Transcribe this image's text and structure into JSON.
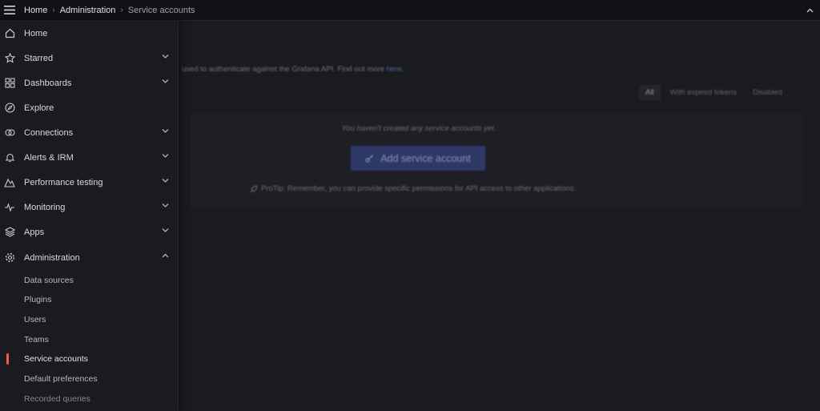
{
  "topbar": {
    "breadcrumbs": [
      "Home",
      "Administration",
      "Service accounts"
    ]
  },
  "main": {
    "description": "used to authenticate against the Grafana API. Find out more",
    "description_link": "here.",
    "filters": [
      "All",
      "With expired tokens",
      "Disabled"
    ],
    "empty_text": "You haven't created any service accounts yet.",
    "add_button": "Add service account",
    "protip": "ProTip: Remember, you can provide specific permissions for API access to other applications."
  },
  "sidebar": {
    "items": [
      {
        "label": "Home",
        "icon": "home-icon"
      },
      {
        "label": "Starred",
        "icon": "star-icon"
      },
      {
        "label": "Dashboards",
        "icon": "dashboards-icon"
      },
      {
        "label": "Explore",
        "icon": "compass-icon"
      },
      {
        "label": "Connections",
        "icon": "connections-icon"
      },
      {
        "label": "Alerts & IRM",
        "icon": "bell-icon"
      },
      {
        "label": "Performance testing",
        "icon": "performance-icon"
      },
      {
        "label": "Monitoring",
        "icon": "heartbeat-icon"
      },
      {
        "label": "Apps",
        "icon": "layers-icon"
      },
      {
        "label": "Administration",
        "icon": "cog-icon"
      }
    ],
    "admin_children": [
      "Data sources",
      "Plugins",
      "Users",
      "Teams",
      "Service accounts",
      "Default preferences",
      "Recorded queries"
    ]
  },
  "colors": {
    "accent_active": "#f55f3e",
    "primary_button": "#3d4d93",
    "sidebar_bg": "#1a1b1f"
  }
}
